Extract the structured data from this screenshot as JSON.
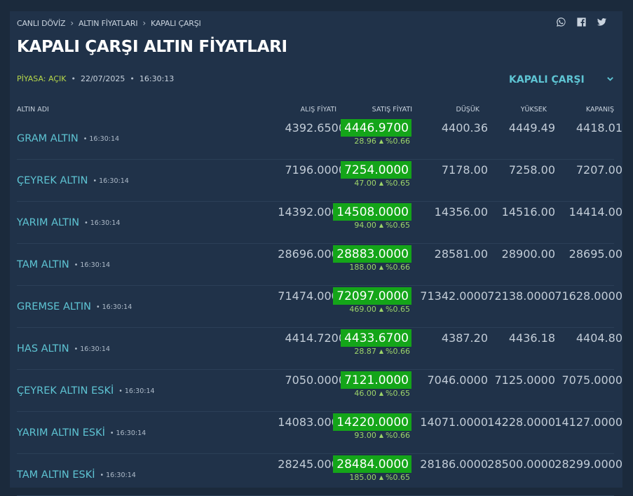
{
  "breadcrumb": [
    "CANLI DÖVİZ",
    "ALTIN FİYATLARI",
    "KAPALI ÇARŞI"
  ],
  "page_title": "KAPALI ÇARŞI ALTIN FİYATLARI",
  "status": {
    "market": "PİYASA: AÇIK",
    "date": "22/07/2025",
    "time": "16:30:13"
  },
  "market_select": {
    "label": "KAPALI ÇARŞI"
  },
  "columns": {
    "name": "ALTIN ADI",
    "buy": "ALIŞ FİYATI",
    "sell": "SATIŞ FİYATI",
    "low": "DÜŞÜK",
    "high": "YÜKSEK",
    "close": "KAPANIŞ"
  },
  "colors": {
    "accent": "#5ec4d3",
    "sell_bg": "#14a519",
    "up": "#9dd46a",
    "market_open": "#b7d84a"
  },
  "icons": [
    "whatsapp-icon",
    "facebook-icon",
    "twitter-icon",
    "chevron-down-icon",
    "arrow-up-icon"
  ],
  "rows": [
    {
      "name": "GRAM ALTIN",
      "time": "16:30:14",
      "buy": "4392.6500",
      "sell": "4446.9700",
      "change": "28.96",
      "pct": "%0.66",
      "low": "4400.36",
      "high": "4449.49",
      "close": "4418.01"
    },
    {
      "name": "ÇEYREK ALTIN",
      "time": "16:30:14",
      "buy": "7196.0000",
      "sell": "7254.0000",
      "change": "47.00",
      "pct": "%0.65",
      "low": "7178.00",
      "high": "7258.00",
      "close": "7207.00"
    },
    {
      "name": "YARIM ALTIN",
      "time": "16:30:14",
      "buy": "14392.0000",
      "sell": "14508.0000",
      "change": "94.00",
      "pct": "%0.65",
      "low": "14356.00",
      "high": "14516.00",
      "close": "14414.00"
    },
    {
      "name": "TAM ALTIN",
      "time": "16:30:14",
      "buy": "28696.0000",
      "sell": "28883.0000",
      "change": "188.00",
      "pct": "%0.66",
      "low": "28581.00",
      "high": "28900.00",
      "close": "28695.00"
    },
    {
      "name": "GREMSE ALTIN",
      "time": "16:30:14",
      "buy": "71474.0000",
      "sell": "72097.0000",
      "change": "469.00",
      "pct": "%0.65",
      "low": "71342.0000",
      "high": "72138.0000",
      "close": "71628.0000"
    },
    {
      "name": "HAS ALTIN",
      "time": "16:30:14",
      "buy": "4414.7200",
      "sell": "4433.6700",
      "change": "28.87",
      "pct": "%0.66",
      "low": "4387.20",
      "high": "4436.18",
      "close": "4404.80"
    },
    {
      "name": "ÇEYREK ALTIN ESKİ",
      "time": "16:30:14",
      "buy": "7050.0000",
      "sell": "7121.0000",
      "change": "46.00",
      "pct": "%0.65",
      "low": "7046.0000",
      "high": "7125.0000",
      "close": "7075.0000"
    },
    {
      "name": "YARIM ALTIN ESKİ",
      "time": "16:30:14",
      "buy": "14083.0000",
      "sell": "14220.0000",
      "change": "93.00",
      "pct": "%0.66",
      "low": "14071.0000",
      "high": "14228.0000",
      "close": "14127.0000"
    },
    {
      "name": "TAM ALTIN ESKİ",
      "time": "16:30:14",
      "buy": "28245.0000",
      "sell": "28484.0000",
      "change": "185.00",
      "pct": "%0.65",
      "low": "28186.0000",
      "high": "28500.0000",
      "close": "28299.0000"
    }
  ]
}
